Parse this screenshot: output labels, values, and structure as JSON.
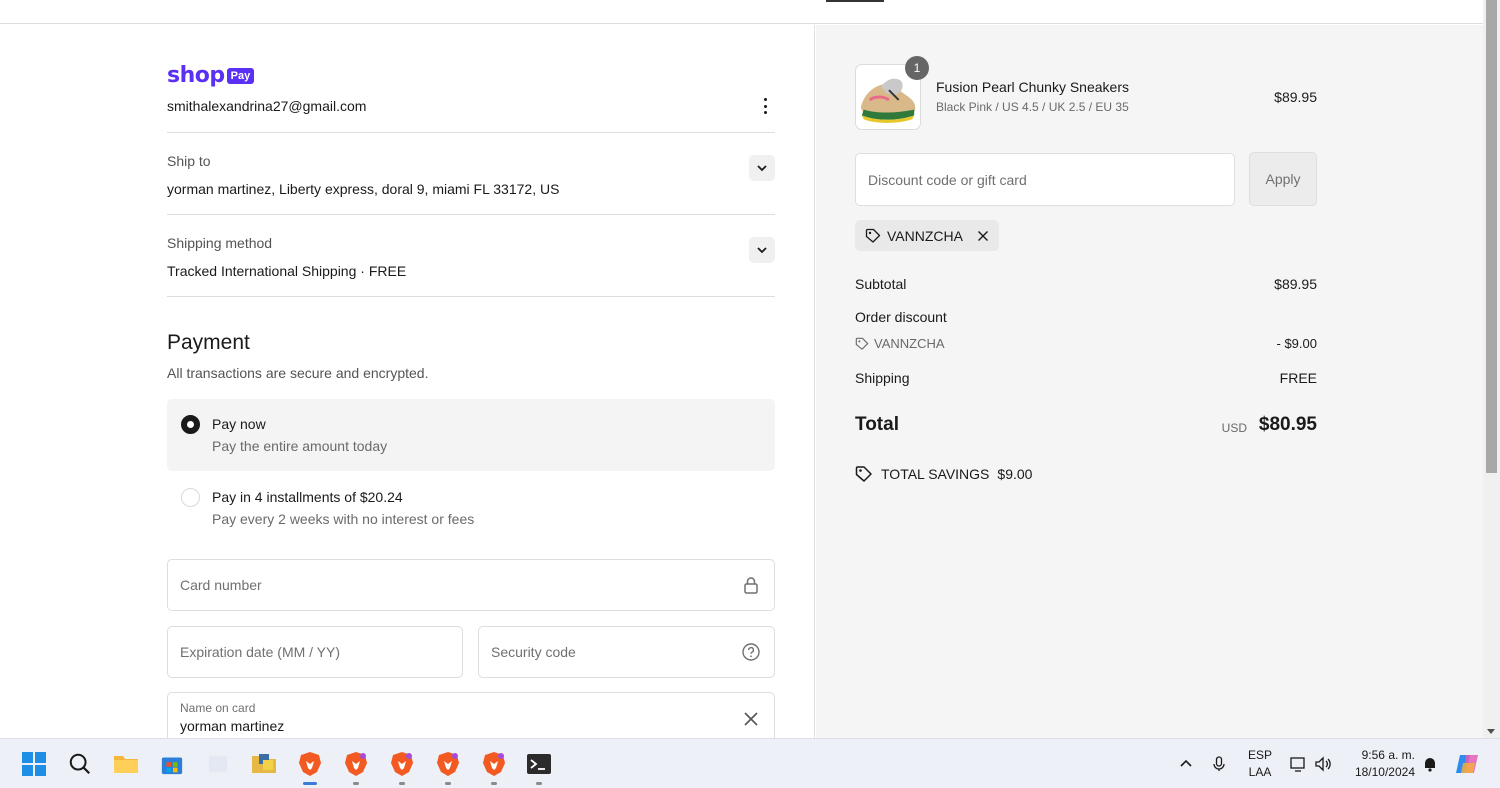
{
  "checkout": {
    "shop_word": "shop",
    "pay_badge": "Pay",
    "email": "smithalexandrina27@gmail.com",
    "ship_to": {
      "label": "Ship to",
      "value": "yorman martinez, Liberty express, doral 9, miami FL 33172, US"
    },
    "shipping_method": {
      "label": "Shipping method",
      "value": "Tracked International Shipping · FREE"
    },
    "payment": {
      "title": "Payment",
      "subtitle": "All transactions are secure and encrypted.",
      "options": [
        {
          "title": "Pay now",
          "sub": "Pay the entire amount today",
          "selected": true
        },
        {
          "title": "Pay in 4 installments of $20.24",
          "sub": "Pay every 2 weeks with no interest or fees",
          "selected": false
        }
      ],
      "card_number_placeholder": "Card number",
      "expiration_placeholder": "Expiration date (MM / YY)",
      "security_code_placeholder": "Security code",
      "name_on_card_label": "Name on card",
      "name_on_card_value": "yorman martinez"
    }
  },
  "summary": {
    "product": {
      "quantity": "1",
      "name": "Fusion Pearl Chunky Sneakers",
      "variant": "Black Pink / US 4.5 / UK 2.5 / EU 35",
      "price": "$89.95"
    },
    "discount_placeholder": "Discount code or gift card",
    "apply_label": "Apply",
    "applied_code": "VANNZCHA",
    "subtotal_label": "Subtotal",
    "subtotal_value": "$89.95",
    "order_discount_label": "Order discount",
    "discount_code": "VANNZCHA",
    "discount_value": "- $9.00",
    "shipping_label": "Shipping",
    "shipping_value": "FREE",
    "total_label": "Total",
    "currency": "USD",
    "total_value": "$80.95",
    "savings_label": "TOTAL SAVINGS",
    "savings_value": "$9.00"
  },
  "taskbar": {
    "lang_top": "ESP",
    "lang_bottom": "LAA",
    "time": "9:56 a. m.",
    "date": "18/10/2024",
    "icons": [
      "windows-start-icon",
      "search-icon",
      "file-explorer-icon",
      "store-icon",
      "photo-icon",
      "folder-python-icon",
      "brave-browser-icon",
      "brave-browser-icon",
      "brave-browser-icon",
      "brave-browser-icon",
      "brave-browser-icon",
      "terminal-icon"
    ]
  },
  "colors": {
    "shop_brand": "#5a31f4",
    "summary_bg": "#f5f5f5",
    "selected_option_bg": "#f4f4f4"
  }
}
